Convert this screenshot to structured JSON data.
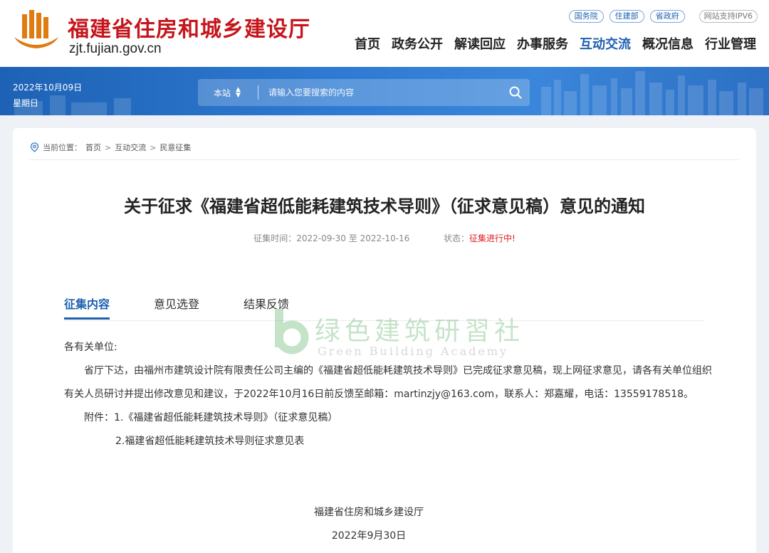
{
  "header": {
    "site_title": "福建省住房和城乡建设厅",
    "site_domain": "zjt.fujian.gov.cn",
    "top_links": [
      "国务院",
      "住建部",
      "省政府"
    ],
    "ipv6": "网站支持IPV6",
    "nav": [
      "首页",
      "政务公开",
      "解读回应",
      "办事服务",
      "互动交流",
      "概况信息",
      "行业管理"
    ],
    "active_nav": "互动交流"
  },
  "banner": {
    "date": "2022年10月09日",
    "weekday": "星期日",
    "search_scope": "本站",
    "search_placeholder": "请输入您要搜索的内容"
  },
  "breadcrumb": {
    "prefix": "当前位置：",
    "items": [
      "首页",
      "互动交流",
      "民意征集"
    ],
    "separator": ">"
  },
  "article": {
    "title": "关于征求《福建省超低能耗建筑技术导则》（征求意见稿）意见的通知",
    "period_label": "征集时间：",
    "period_value": "2022-09-30 至 2022-10-16",
    "status_label": "状态：",
    "status_value": "征集进行中!",
    "tabs": [
      "征集内容",
      "意见选登",
      "结果反馈"
    ],
    "active_tab": "征集内容",
    "greeting": "各有关单位:",
    "paragraph": "省厅下达，由福州市建筑设计院有限责任公司主编的《福建省超低能耗建筑技术导则》已完成征求意见稿，现上网征求意见，请各有关单位组织有关人员研讨并提出修改意见和建议，于2022年10月16日前反馈至邮箱：martinzjy@163.com，联系人：郑嘉耀，电话：13559178518。",
    "attachment_1": "附件：1.《福建省超低能耗建筑技术导则》（征求意见稿）",
    "attachment_2": "2.福建省超低能耗建筑技术导则征求意见表",
    "signature": "福建省住房和城乡建设厅",
    "sign_date": "2022年9月30日"
  },
  "watermark": {
    "cn": "绿色建筑研習社",
    "en": "Green Building Academy"
  },
  "colors": {
    "brand_red": "#c4161c",
    "brand_blue": "#1f5fb0",
    "status_red": "#e02020"
  }
}
